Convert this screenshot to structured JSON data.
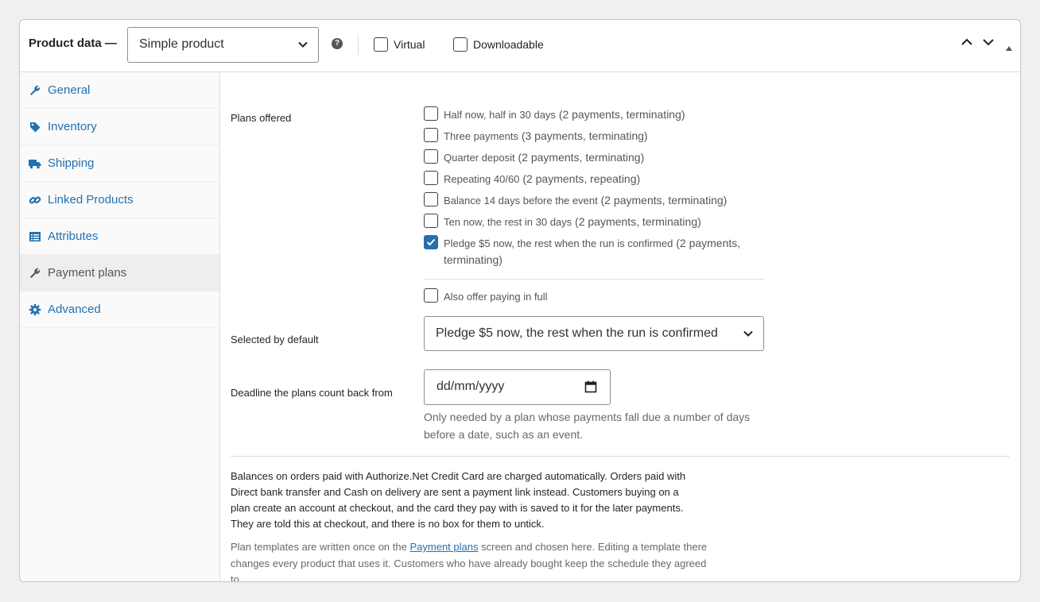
{
  "header": {
    "title": "Product data —",
    "product_type": "Simple product",
    "help_icon": "question-circle-icon",
    "virtual_label": "Virtual",
    "downloadable_label": "Downloadable"
  },
  "sidebar": {
    "items": [
      {
        "label": "General",
        "icon": "wrench-icon",
        "active": false
      },
      {
        "label": "Inventory",
        "icon": "tag-icon",
        "active": false
      },
      {
        "label": "Shipping",
        "icon": "truck-icon",
        "active": false
      },
      {
        "label": "Linked Products",
        "icon": "link-icon",
        "active": false
      },
      {
        "label": "Attributes",
        "icon": "list-icon",
        "active": false
      },
      {
        "label": "Payment plans",
        "icon": "wrench-icon",
        "active": true
      },
      {
        "label": "Advanced",
        "icon": "gear-icon",
        "active": false
      }
    ]
  },
  "plans": {
    "label": "Plans offered",
    "options": [
      {
        "name": "Half now, half in 30 days",
        "detail": "(2 payments, terminating)",
        "checked": false
      },
      {
        "name": "Three payments",
        "detail": "(3 payments, terminating)",
        "checked": false
      },
      {
        "name": "Quarter deposit",
        "detail": "(2 payments, terminating)",
        "checked": false
      },
      {
        "name": "Repeating 40/60",
        "detail": "(2 payments, repeating)",
        "checked": false
      },
      {
        "name": "Balance 14 days before the event",
        "detail": "(2 payments, terminating)",
        "checked": false
      },
      {
        "name": "Ten now, the rest in 30 days",
        "detail": "(2 payments, terminating)",
        "checked": false
      },
      {
        "name": "Pledge $5 now, the rest when the run is confirmed",
        "detail": "(2 payments,",
        "detail_line2": "terminating)",
        "checked": true
      }
    ],
    "pay_in_full_label": "Also offer paying in full"
  },
  "default_plan": {
    "label": "Selected by default",
    "value": "Pledge $5 now, the rest when the run is confirmed"
  },
  "deadline": {
    "label": "Deadline the plans count back from",
    "placeholder": "dd/mm/yyyy",
    "description": "Only needed by a plan whose payments fall due a number of days before a date, such as an event."
  },
  "notes": {
    "gateway": "Balances on orders paid with Authorize.Net Credit Card are charged automatically. Orders paid with Direct bank transfer and Cash on delivery are sent a payment link instead. Customers buying on a plan create an account at checkout, and the card they pay with is saved to it for the later payments. They are told this at checkout, and there is no box for them to untick.",
    "templates_before": "Plan templates are written once on the",
    "templates_link": "Payment plans",
    "templates_after": "screen and chosen here. Editing a template there changes every product that uses it. Customers who have already bought keep the schedule they agreed to."
  },
  "colors": {
    "accent": "#2271b1",
    "active_tab_bg": "#eeeeee",
    "border": "#dcdcde"
  }
}
